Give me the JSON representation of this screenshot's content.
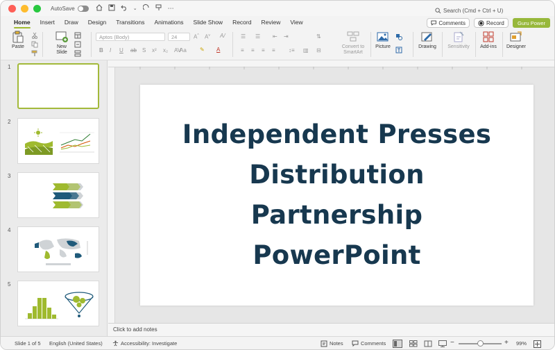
{
  "titlebar": {
    "autosave_label": "AutoSave",
    "search_placeholder": "Search (Cmd + Ctrl + U)"
  },
  "tabs": [
    "Home",
    "Insert",
    "Draw",
    "Design",
    "Transitions",
    "Animations",
    "Slide Show",
    "Record",
    "Review",
    "View"
  ],
  "active_tab": "Home",
  "top_buttons": {
    "comments": "Comments",
    "record": "Record",
    "guru": "Guru Power"
  },
  "ribbon": {
    "paste": "Paste",
    "new_slide_1": "New",
    "new_slide_2": "Slide",
    "font_name": "Aptos (Body)",
    "font_size": "24",
    "convert_smartart_1": "Convert to",
    "convert_smartart_2": "SmartArt",
    "picture": "Picture",
    "drawing": "Drawing",
    "sensitivity": "Sensitivity",
    "addins": "Add-ins",
    "designer": "Designer"
  },
  "slides": [
    {
      "num": "1"
    },
    {
      "num": "2"
    },
    {
      "num": "3"
    },
    {
      "num": "4"
    },
    {
      "num": "5"
    }
  ],
  "slide": {
    "title_line1": "Independent Presses",
    "title_line2": "Distribution",
    "title_line3": "Partnership",
    "title_line4": "PowerPoint"
  },
  "notes_placeholder": "Click to add notes",
  "status": {
    "slide_count": "Slide 1 of 5",
    "language": "English (United States)",
    "accessibility": "Accessibility: Investigate",
    "notes": "Notes",
    "comments": "Comments",
    "zoom": "99%"
  },
  "colors": {
    "accent_green": "#9fba2f",
    "title_navy": "#17384f",
    "thumb_blue": "#1f5a7a",
    "thumb_grey": "#cfd3d6"
  }
}
